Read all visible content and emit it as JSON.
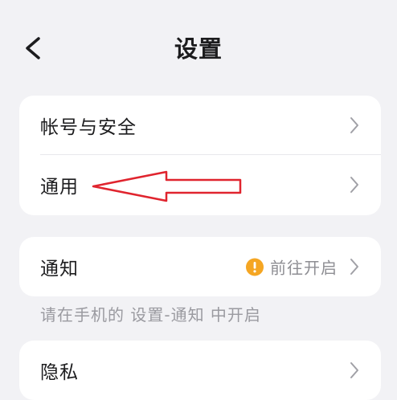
{
  "header": {
    "title": "设置"
  },
  "account_section": {
    "items": [
      {
        "label": "帐号与安全"
      },
      {
        "label": "通用"
      }
    ]
  },
  "notification_section": {
    "label": "通知",
    "status_text": "前往开启",
    "hint": "请在手机的 设置-通知 中开启"
  },
  "privacy_section": {
    "label": "隐私"
  },
  "icons": {
    "back": "chevron-left-icon",
    "row_arrow": "chevron-right-icon",
    "warning": "exclamation-circle-icon"
  },
  "colors": {
    "background": "#f2f2f5",
    "card": "#ffffff",
    "warning": "#f5a623",
    "annotation": "#e0242e"
  }
}
